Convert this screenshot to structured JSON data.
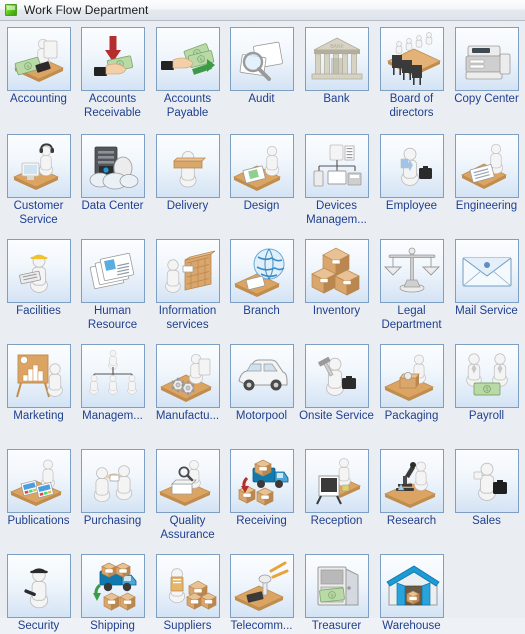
{
  "window": {
    "title": "Work Flow Department",
    "icon": "green-square-icon",
    "background_color": "#eaeef3",
    "titlebar_text_color": "#1b1b1b"
  },
  "stencil": {
    "label_color": "#1f3f8f",
    "tile_border_color": "#7d9fc4",
    "columns": 7,
    "rows": 8,
    "shapes": [
      {
        "label": "Accounting",
        "icon": "accounting-desk-icon",
        "row": 0,
        "col": 0
      },
      {
        "label": "Accounts Receivable",
        "icon": "hand-receiving-money-icon",
        "row": 0,
        "col": 1
      },
      {
        "label": "Accounts Payable",
        "icon": "hand-paying-money-icon",
        "row": 0,
        "col": 2
      },
      {
        "label": "Audit",
        "icon": "magnifier-documents-icon",
        "row": 0,
        "col": 3
      },
      {
        "label": "Bank",
        "icon": "bank-building-icon",
        "row": 0,
        "col": 4
      },
      {
        "label": "Board of directors",
        "icon": "conference-table-icon",
        "row": 0,
        "col": 5
      },
      {
        "label": "Copy Center",
        "icon": "copier-machine-icon",
        "row": 0,
        "col": 6
      },
      {
        "label": "Customer Service",
        "icon": "headset-agent-icon",
        "row": 1,
        "col": 0
      },
      {
        "label": "Data Center",
        "icon": "server-cloud-icon",
        "row": 1,
        "col": 1
      },
      {
        "label": "Delivery",
        "icon": "person-carrying-box-icon",
        "row": 1,
        "col": 2
      },
      {
        "label": "Design",
        "icon": "design-desk-icon",
        "row": 1,
        "col": 3
      },
      {
        "label": "Devices Managem...",
        "icon": "devices-network-icon",
        "row": 1,
        "col": 4
      },
      {
        "label": "Employee",
        "icon": "employee-briefcase-icon",
        "row": 1,
        "col": 5
      },
      {
        "label": "Engineering",
        "icon": "engineering-desk-icon",
        "row": 1,
        "col": 6
      },
      {
        "label": "Facilities",
        "icon": "hardhat-worker-icon",
        "row": 2,
        "col": 0
      },
      {
        "label": "Human Resource",
        "icon": "resume-papers-icon",
        "row": 2,
        "col": 1
      },
      {
        "label": "Information services",
        "icon": "person-file-cabinet-icon",
        "row": 2,
        "col": 2
      },
      {
        "label": "Branch",
        "icon": "globe-desk-icon",
        "row": 2,
        "col": 3
      },
      {
        "label": "Inventory",
        "icon": "stacked-boxes-icon",
        "row": 2,
        "col": 4
      },
      {
        "label": "Legal Department",
        "icon": "scales-of-justice-icon",
        "row": 2,
        "col": 5
      },
      {
        "label": "Mail Service",
        "icon": "envelope-icon",
        "row": 2,
        "col": 6
      },
      {
        "label": "Marketing",
        "icon": "presentation-chart-icon",
        "row": 3,
        "col": 0
      },
      {
        "label": "Managem...",
        "icon": "org-chart-icon",
        "row": 3,
        "col": 1
      },
      {
        "label": "Manufactu...",
        "icon": "factory-gears-desk-icon",
        "row": 3,
        "col": 2
      },
      {
        "label": "Motorpool",
        "icon": "car-icon",
        "row": 3,
        "col": 3
      },
      {
        "label": "Onsite Service",
        "icon": "technician-toolcase-icon",
        "row": 3,
        "col": 4
      },
      {
        "label": "Packaging",
        "icon": "packing-box-desk-icon",
        "row": 3,
        "col": 5
      },
      {
        "label": "Payroll",
        "icon": "two-people-money-icon",
        "row": 3,
        "col": 6
      },
      {
        "label": "Publications",
        "icon": "printed-magazines-icon",
        "row": 4,
        "col": 0
      },
      {
        "label": "Purchasing",
        "icon": "two-people-handoff-icon",
        "row": 4,
        "col": 1
      },
      {
        "label": "Quality Assurance",
        "icon": "inspect-box-icon",
        "row": 4,
        "col": 2
      },
      {
        "label": "Receiving",
        "icon": "truck-unloading-icon",
        "row": 4,
        "col": 3
      },
      {
        "label": "Reception",
        "icon": "reception-desk-icon",
        "row": 4,
        "col": 4
      },
      {
        "label": "Research",
        "icon": "microscope-icon",
        "row": 4,
        "col": 5
      },
      {
        "label": "Sales",
        "icon": "salesperson-case-icon",
        "row": 4,
        "col": 6
      },
      {
        "label": "Security",
        "icon": "security-guard-icon",
        "row": 5,
        "col": 0
      },
      {
        "label": "Shipping",
        "icon": "shipping-truck-icon",
        "row": 5,
        "col": 1
      },
      {
        "label": "Suppliers",
        "icon": "supplier-clipboard-icon",
        "row": 5,
        "col": 2
      },
      {
        "label": "Telecomm...",
        "icon": "telecom-desk-icon",
        "row": 5,
        "col": 3
      },
      {
        "label": "Treasurer",
        "icon": "safe-cabinet-money-icon",
        "row": 5,
        "col": 4
      },
      {
        "label": "Warehouse",
        "icon": "warehouse-building-icon",
        "row": 5,
        "col": 5
      }
    ]
  }
}
